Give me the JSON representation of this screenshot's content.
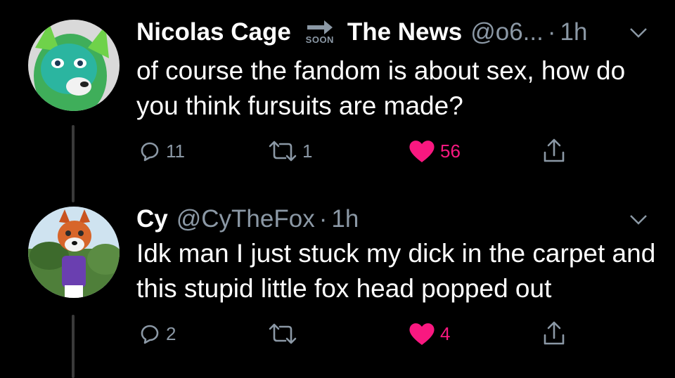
{
  "tweets": [
    {
      "author_name": "Nicolas Cage",
      "retweet_label": "SOON",
      "quoted_name": "The News",
      "handle": "@o6...",
      "separator": "·",
      "time": "1h",
      "text": "of course the fandom is about sex, how do you think fursuits are made?",
      "replies": "11",
      "retweets": "1",
      "likes": "56",
      "avatar": "green-fursuit-avatar"
    },
    {
      "author_name": "Cy",
      "handle": "@CyTheFox",
      "separator": "·",
      "time": "1h",
      "text": "Idk man I just stuck my dick in the carpet and this stupid little fox head popped out",
      "replies": "2",
      "retweets": "",
      "likes": "4",
      "avatar": "fox-fursuit-avatar"
    }
  ],
  "icons": {
    "reply": "reply-icon",
    "retweet": "retweet-icon",
    "like": "heart-icon",
    "share": "share-icon",
    "more": "chevron-down-icon"
  },
  "colors": {
    "background": "#000000",
    "text": "#ffffff",
    "secondary": "#8b98a5",
    "like": "#f91880",
    "thread_line": "#3a3a3a"
  }
}
